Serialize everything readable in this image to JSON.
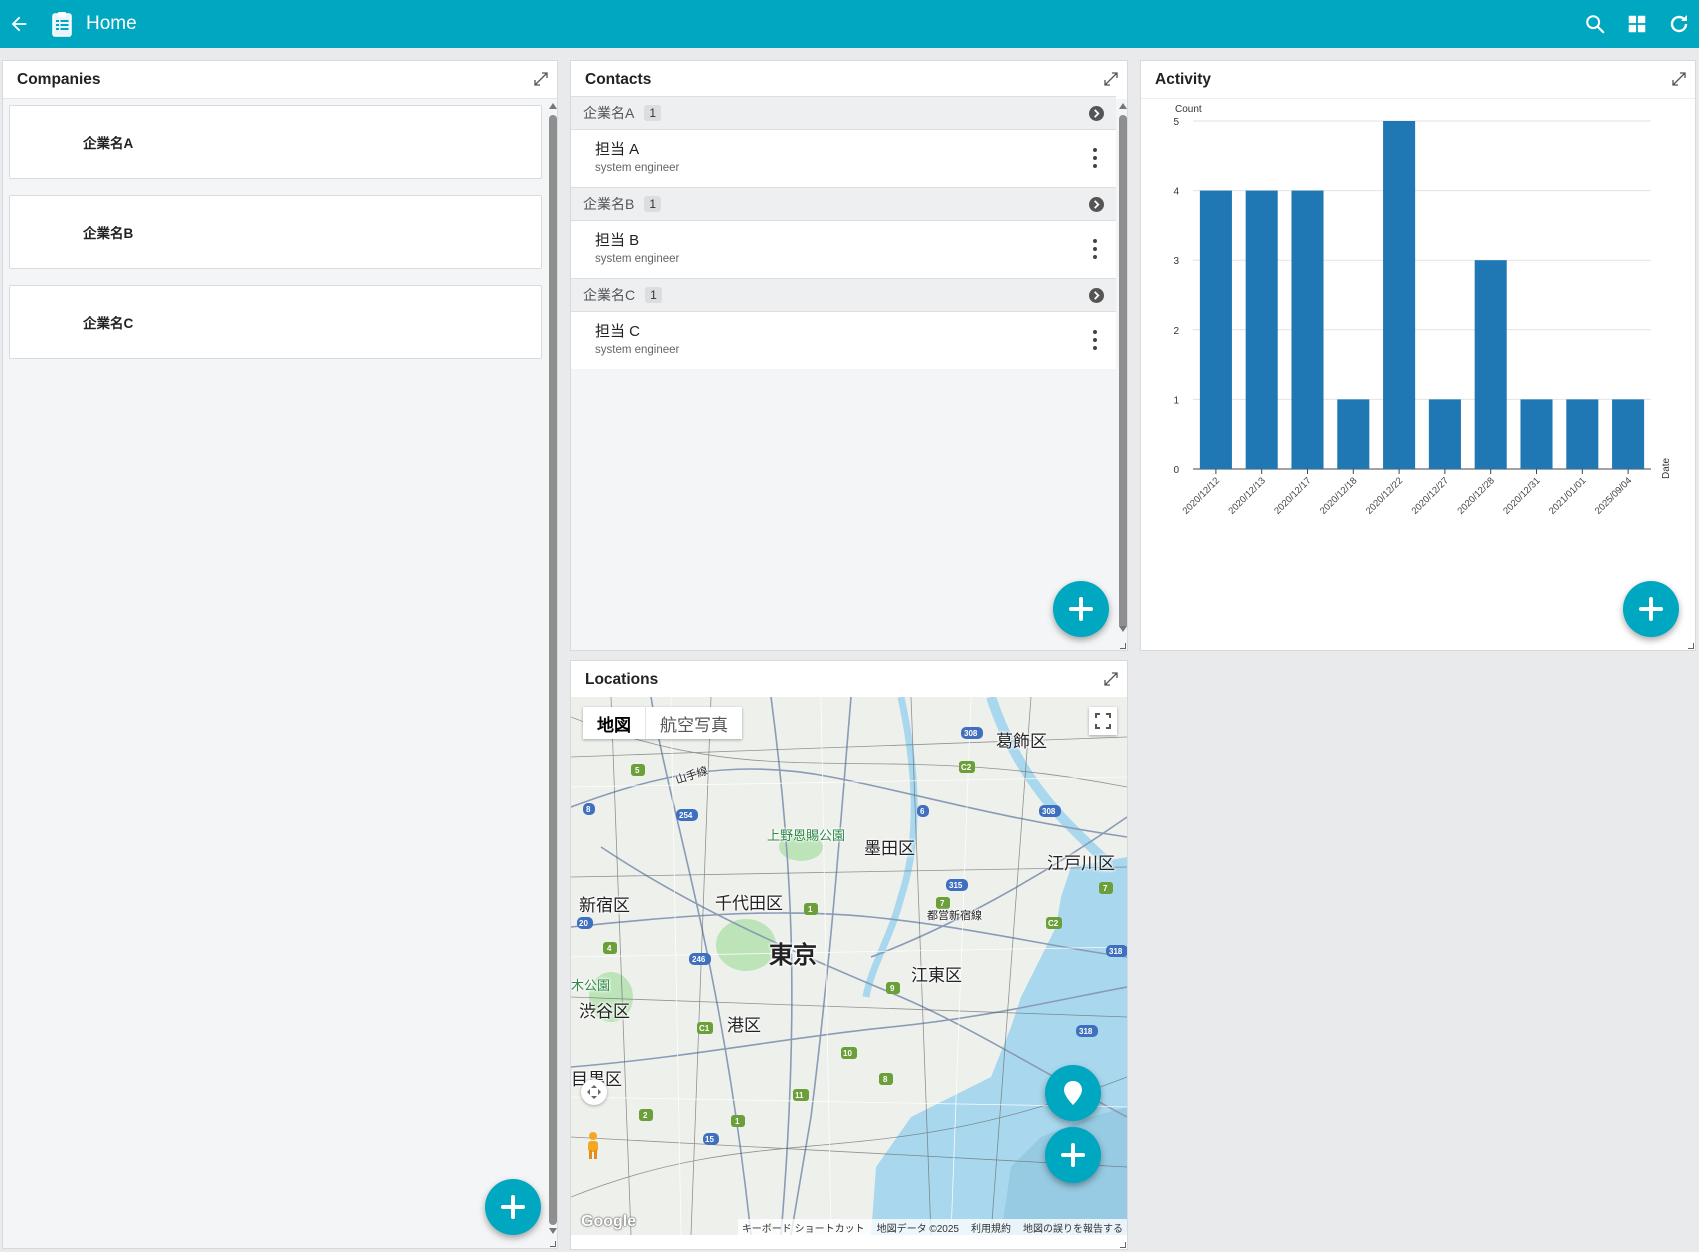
{
  "app": {
    "title": "Home"
  },
  "companies": {
    "title": "Companies",
    "items": [
      "企業名A",
      "企業名B",
      "企業名C"
    ]
  },
  "contacts": {
    "title": "Contacts",
    "groups": [
      {
        "company": "企業名A",
        "count": "1",
        "name": "担当 A",
        "role": "system engineer"
      },
      {
        "company": "企業名B",
        "count": "1",
        "name": "担当 B",
        "role": "system engineer"
      },
      {
        "company": "企業名C",
        "count": "1",
        "name": "担当 C",
        "role": "system engineer"
      }
    ]
  },
  "activity": {
    "title": "Activity",
    "chart_data": {
      "type": "bar",
      "categories": [
        "2020/12/12",
        "2020/12/13",
        "2020/12/17",
        "2020/12/18",
        "2020/12/22",
        "2020/12/27",
        "2020/12/28",
        "2020/12/31",
        "2021/01/01",
        "2025/09/04"
      ],
      "values": [
        4,
        4,
        4,
        1,
        5,
        1,
        3,
        1,
        1,
        1
      ],
      "ylabel": "Count",
      "xlabel": "Date",
      "ylim": [
        0,
        5
      ],
      "yticks": [
        0,
        1,
        2,
        3,
        4,
        5
      ],
      "grid": true,
      "color": "#1f77b4"
    }
  },
  "locations": {
    "title": "Locations",
    "map_tabs": [
      "地図",
      "航空写真"
    ],
    "labels": {
      "katsushika": "葛飾区",
      "ueno": "上野恩賜公園",
      "sumida": "墨田区",
      "edogawa": "江戸川区",
      "shinjuku": "新宿区",
      "chiyoda": "千代田区",
      "tokyo": "東京",
      "koto": "江東区",
      "shibuya": "渋谷区",
      "minato": "港区",
      "meguro": "目黒区",
      "yoyogi": "木公園",
      "toei": "都営新宿線",
      "yamanote": "山手線"
    },
    "footer": [
      "キーボード ショートカット",
      "地図データ ©2025",
      "利用規約",
      "地図の誤りを報告する"
    ],
    "google": "Google"
  },
  "colors": {
    "accent": "#00a7c0",
    "bar": "#1f77b4"
  }
}
